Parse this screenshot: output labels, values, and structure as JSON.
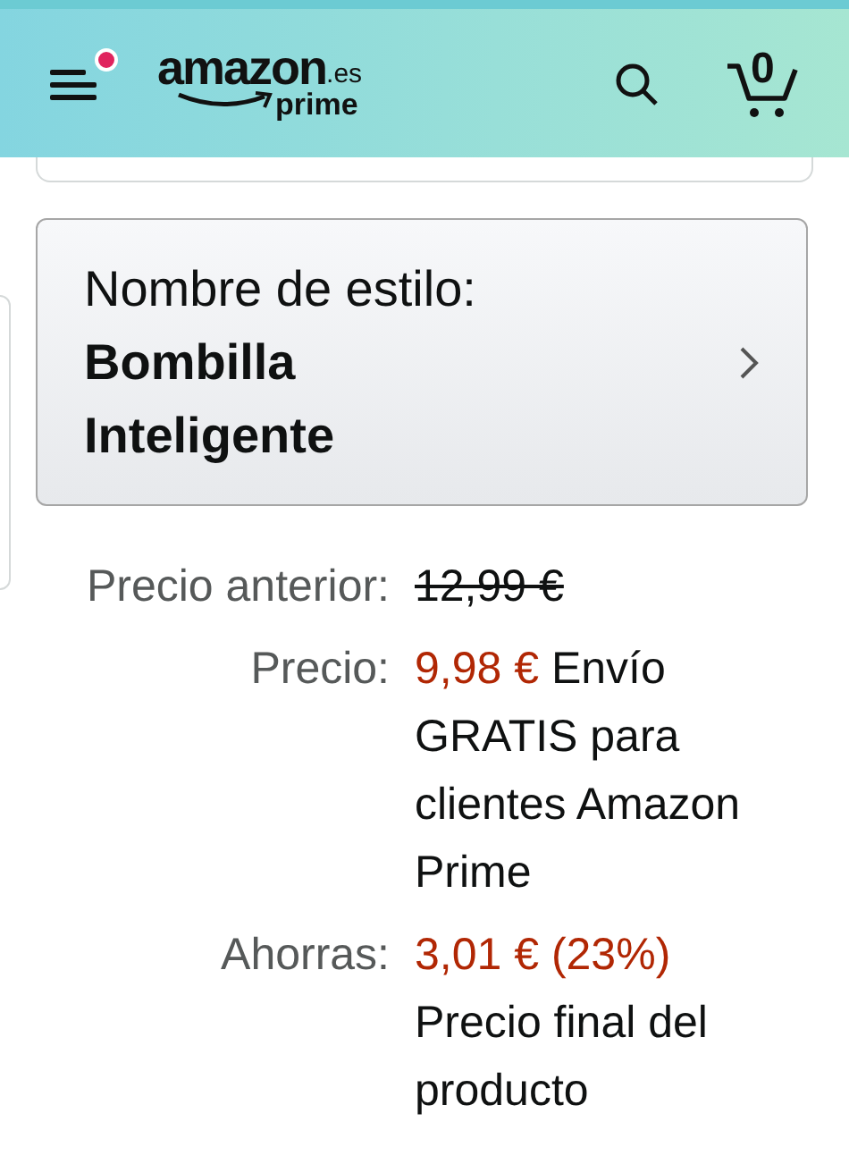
{
  "header": {
    "menu_has_notification": true,
    "logo": {
      "wordmark": "amazon",
      "domain": ".es",
      "tier": "prime"
    },
    "cart_count": "0"
  },
  "style_selector": {
    "label": "Nombre de estilo:",
    "value": "Bombilla Inteligente"
  },
  "prices": [
    {
      "kind": "old",
      "label": "Precio anterior:",
      "amount": "12,99 €"
    },
    {
      "kind": "current",
      "label": "Precio:",
      "amount": "9,98 €",
      "note": "Envío GRATIS para clientes Amazon Prime"
    },
    {
      "kind": "savings",
      "label": "Ahorras:",
      "amount": "3,01 € (23%)",
      "note": "Precio final del producto"
    }
  ]
}
